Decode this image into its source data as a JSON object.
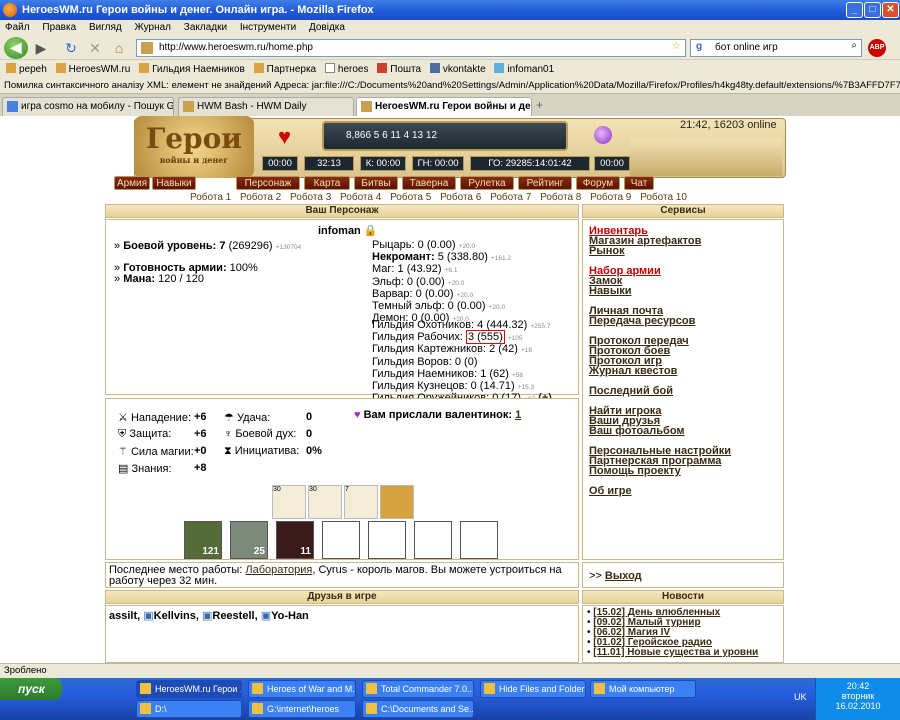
{
  "window": {
    "title": "HeroesWM.ru Герои войны и денег. Онлайн игра. - Mozilla Firefox"
  },
  "menu": [
    "Файл",
    "Правка",
    "Вигляд",
    "Журнал",
    "Закладки",
    "Інструменти",
    "Довідка"
  ],
  "nav": {
    "url": "http://www.heroeswm.ru/home.php",
    "search_value": "бот online игр"
  },
  "bookmarks": [
    "pepeh",
    "HeroesWM.ru",
    "Гильдия Наемников",
    "Партнерка",
    "heroes",
    "Пошта",
    "vkontakte",
    "infoman01"
  ],
  "error_bar": "Помилка синтаксичного аналізу XML: елемент не знайдений Адреса: jar:file:///C:/Documents%20and%20Settings/Admin/Application%20Data/Mozilla/Firefox/Profiles/h4kg48ty.default/extensions/%7B3AFFD7F7-FD3D-4C9D-8F83-03296A1A8840%7D/chrom",
  "tabs": [
    "игра cosmo на мобилу - Пошук Google",
    "HWM Bash - HWM Daily",
    "HeroesWM.ru Герои войны и де..."
  ],
  "game": {
    "online": "21:42, 16203 online",
    "logo": "Герои",
    "logo_sub": "войны и денег",
    "resources": "8,866  5  6  11  4  13  12",
    "timers": [
      "00:00",
      "32:13",
      "К: 00:00",
      "ГН: 00:00",
      "ГО: 29285:14:01:42",
      "00:00"
    ],
    "side_tabs": [
      "Армия",
      "Навыки"
    ],
    "menu": [
      "Персонаж",
      "Карта",
      "Битвы",
      "Таверна",
      "Рулетка",
      "Рейтинг",
      "Форум",
      "Чат"
    ],
    "robots": [
      "Робота 1",
      "Робота 2",
      "Робота 3",
      "Робота 4",
      "Робота 5",
      "Робота 6",
      "Робота 7",
      "Робота 8",
      "Робота 9",
      "Робота 10"
    ]
  },
  "character": {
    "heading": "Ваш Персонаж",
    "name": "infoman",
    "level_label": "Боевой уровень:",
    "level_value": "7",
    "level_exp": "(269296)",
    "level_next": "+130704",
    "ready_label": "Готовность армии:",
    "ready_value": "100%",
    "mana_label": "Мана:",
    "mana_value": "120 / 120",
    "factions": [
      {
        "name": "Рыцарь:",
        "value": "0 (0.00)",
        "plus": "+20.0",
        "bold": false
      },
      {
        "name": "Некромант:",
        "value": "5 (338.80)",
        "plus": "+161.2",
        "bold": true
      },
      {
        "name": "Маг:",
        "value": "1 (43.92)",
        "plus": "+6.1",
        "bold": false
      },
      {
        "name": "Эльф:",
        "value": "0 (0.00)",
        "plus": "+20.0",
        "bold": false
      },
      {
        "name": "Варвар:",
        "value": "0 (0.00)",
        "plus": "+20.0",
        "bold": false
      },
      {
        "name": "Темный эльф:",
        "value": "0 (0.00)",
        "plus": "+20.0",
        "bold": false
      },
      {
        "name": "Демон:",
        "value": "0 (0.00)",
        "plus": "+20.0",
        "bold": false
      }
    ],
    "guilds": [
      {
        "name": "Гильдия Охотников:",
        "value": "4 (444.32)",
        "plus": "+255.7"
      },
      {
        "name": "Гильдия Рабочих:",
        "value": "3 (555)",
        "plus": "+105"
      },
      {
        "name": "Гильдия Картежников:",
        "value": "2 (42)",
        "plus": "+18"
      },
      {
        "name": "Гильдия Воров:",
        "value": "0 (0)",
        "plus": ""
      },
      {
        "name": "Гильдия Наемников:",
        "value": "1 (62)",
        "plus": "+58"
      },
      {
        "name": "Гильдия Кузнецов:",
        "value": "0 (14.71)",
        "plus": "+15.3"
      },
      {
        "name": "Гильдия Оружейников:",
        "value": "0 (17)",
        "plus": "+97"
      }
    ],
    "guild_plus_btn": "(+)"
  },
  "stats": {
    "attack": {
      "label": "Нападение:",
      "value": "+6"
    },
    "defense": {
      "label": "Защита:",
      "value": "+6"
    },
    "spellpower": {
      "label": "Сила магии:",
      "value": "+0"
    },
    "knowledge": {
      "label": "Знания:",
      "value": "+8"
    },
    "luck": {
      "label": "Удача:",
      "value": "0"
    },
    "morale": {
      "label": "Боевой дух:",
      "value": "0"
    },
    "initiative": {
      "label": "Инициатива:",
      "value": "0%"
    },
    "valentine_text": "Вам прислали валентинок:",
    "valentine_count": "1",
    "artifacts": [
      "30",
      "30",
      "7",
      ""
    ],
    "army": [
      "121",
      "25",
      "11",
      "",
      "",
      "",
      ""
    ]
  },
  "work": {
    "text1": "Последнее место работы:",
    "place": "Лаборатория",
    "text2": ", Cyrus - король магов. Вы можете устроиться на работу через 32 мин."
  },
  "exit": {
    "prefix": ">>",
    "label": "Выход"
  },
  "friends": {
    "heading": "Друзья в игре",
    "names": [
      "assilt,",
      "Kellvins,",
      "Reestell,",
      "Yo-Han"
    ]
  },
  "services": {
    "heading": "Сервисы",
    "groups": [
      [
        {
          "label": "Инвентарь",
          "red": true
        },
        {
          "label": "Магазин артефактов",
          "red": false
        },
        {
          "label": "Рынок",
          "red": false
        }
      ],
      [
        {
          "label": "Набор армии",
          "red": true
        },
        {
          "label": "Замок",
          "red": false
        },
        {
          "label": "Навыки",
          "red": false
        }
      ],
      [
        {
          "label": "Личная почта",
          "red": false
        },
        {
          "label": "Передача ресурсов",
          "red": false
        }
      ],
      [
        {
          "label": "Протокол передач",
          "red": false
        },
        {
          "label": "Протокол боев",
          "red": false
        },
        {
          "label": "Протокол игр",
          "red": false
        },
        {
          "label": "Журнал квестов",
          "red": false
        }
      ],
      [
        {
          "label": "Последний бой",
          "red": false
        }
      ],
      [
        {
          "label": "Найти игрока",
          "red": false
        },
        {
          "label": "Ваши друзья",
          "red": false
        },
        {
          "label": "Ваш фотоальбом",
          "red": false
        }
      ],
      [
        {
          "label": "Персональные настройки",
          "red": false
        },
        {
          "label": "Партнерская программа",
          "red": false
        },
        {
          "label": "Помощь проекту",
          "red": false
        }
      ],
      [
        {
          "label": "Об игре",
          "red": false
        }
      ]
    ]
  },
  "news": {
    "heading": "Новости",
    "items": [
      "[15.02] День влюбленных",
      "[09.02] Малый турнир",
      "[06.02] Магия IV",
      "[01.02] Геройское радио",
      "[11.01] Новые существа и уровни"
    ]
  },
  "statusbar": "Зроблено",
  "taskbar": {
    "start": "пуск",
    "row1": [
      "HeroesWM.ru Герои ...",
      "Heroes of War and M...",
      "Total Commander 7.0...",
      "Hide Files and Folders",
      "Мой компьютер"
    ],
    "row2": [
      "D:\\",
      "G:\\internet\\heroes",
      "C:\\Documents and Se..."
    ],
    "clock": "20:42",
    "day": "вторник",
    "date": "16.02.2010",
    "lang": "UK"
  }
}
